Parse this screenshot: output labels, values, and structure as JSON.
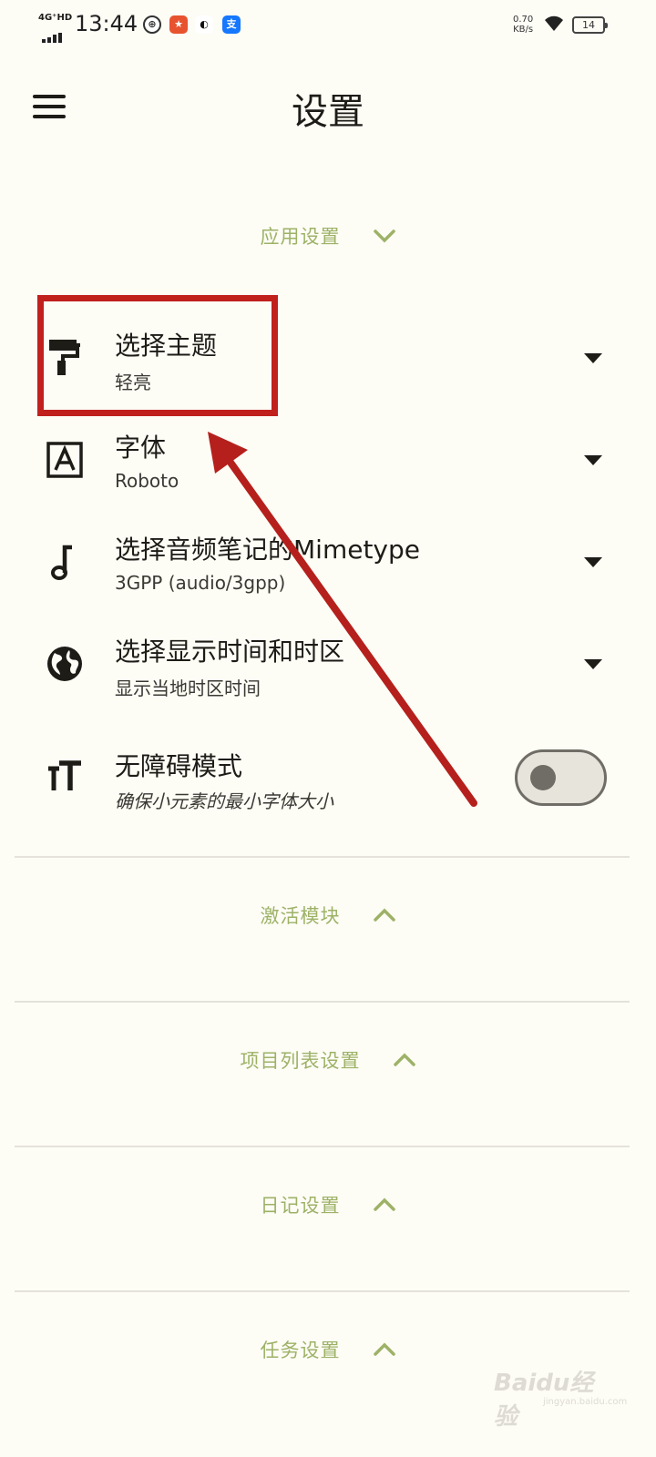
{
  "status_bar": {
    "network": "4G⁺HD",
    "time": "13:44",
    "speed_value": "0.70",
    "speed_unit": "KB/s",
    "battery": "14"
  },
  "app_bar": {
    "title": "设置"
  },
  "sections": {
    "app_settings": "应用设置",
    "activate_modules": "激活模块",
    "project_list_settings": "项目列表设置",
    "diary_settings": "日记设置",
    "task_settings": "任务设置"
  },
  "settings": {
    "theme": {
      "title": "选择主题",
      "value": "轻亮"
    },
    "font": {
      "title": "字体",
      "value": "Roboto"
    },
    "audio_mimetype": {
      "title": "选择音频笔记的Mimetype",
      "value": "3GPP (audio/3gpp)"
    },
    "time_zone": {
      "title": "选择显示时间和时区",
      "value": "显示当地时区时间"
    },
    "accessibility": {
      "title": "无障碍模式",
      "description": "确保小元素的最小字体大小",
      "enabled": false
    }
  },
  "colors": {
    "accent": "#9db267",
    "annotation": "#c0211d",
    "background": "#fdfcf5"
  },
  "watermark": {
    "main": "Baidu经验",
    "sub": "jingyan.baidu.com"
  }
}
